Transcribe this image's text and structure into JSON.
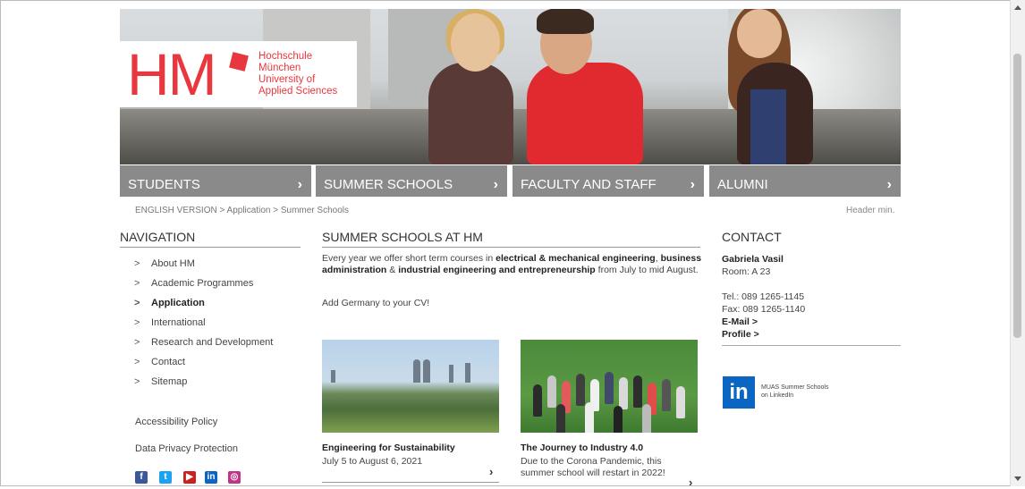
{
  "logo": {
    "mark": "HM",
    "text_lines": [
      "Hochschule",
      "München",
      "University of",
      "Applied Sciences"
    ]
  },
  "mainnav": [
    {
      "label": "STUDENTS",
      "icon": "chevron-right-icon"
    },
    {
      "label": "SUMMER SCHOOLS",
      "icon": "chevron-right-icon"
    },
    {
      "label": "FACULTY AND STAFF",
      "icon": "chevron-right-icon"
    },
    {
      "label": "ALUMNI",
      "icon": "chevron-right-icon"
    }
  ],
  "breadcrumb": "ENGLISH VERSION > Application > Summer Schools",
  "header_min": "Header min.",
  "navigation": {
    "title": "NAVIGATION",
    "bullet": ">",
    "items": [
      {
        "label": "About HM",
        "active": false
      },
      {
        "label": "Academic Programmes",
        "active": false
      },
      {
        "label": "Application",
        "active": true
      },
      {
        "label": "International",
        "active": false
      },
      {
        "label": "Research and Development",
        "active": false
      },
      {
        "label": "Contact",
        "active": false
      },
      {
        "label": "Sitemap",
        "active": false
      }
    ],
    "accessibility": "Accessibility Policy",
    "privacy": "Data Privacy Protection",
    "socials": [
      "facebook-icon",
      "twitter-icon",
      "youtube-icon",
      "linkedin-icon",
      "instagram-icon"
    ]
  },
  "main": {
    "title": "SUMMER SCHOOLS AT HM",
    "intro": {
      "p1": "Every year we offer short term courses in ",
      "b1": "electrical & mechanical engineering",
      "p2": ", ",
      "b2": "business administration",
      "p3": " & ",
      "b3": "industrial engineering and entrepreneurship",
      "p4": " from July to mid August."
    },
    "cv": "Add Germany to your CV!",
    "cards": [
      {
        "title": "Engineering for Sustainability",
        "text": "July 5 to August 6, 2021"
      },
      {
        "title": "The Journey to Industry 4.0",
        "text": "Due to the Corona Pandemic, this summer school will restart in 2022!"
      }
    ]
  },
  "contact": {
    "title": "CONTACT",
    "name": "Gabriela Vasil",
    "room": "Room: A 23",
    "tel": "Tel.: 089 1265-1145",
    "fax": "Fax: 089 1265-1140",
    "email": "E-Mail >",
    "profile": "Profile >",
    "linkedin_mark": "in",
    "linkedin_text_1": "MUAS Summer Schools",
    "linkedin_text_2": "on LinkedIn"
  },
  "colors": {
    "brand": "#e8373e",
    "nav": "#8a8a8a",
    "linkedin": "#0a66c2"
  }
}
